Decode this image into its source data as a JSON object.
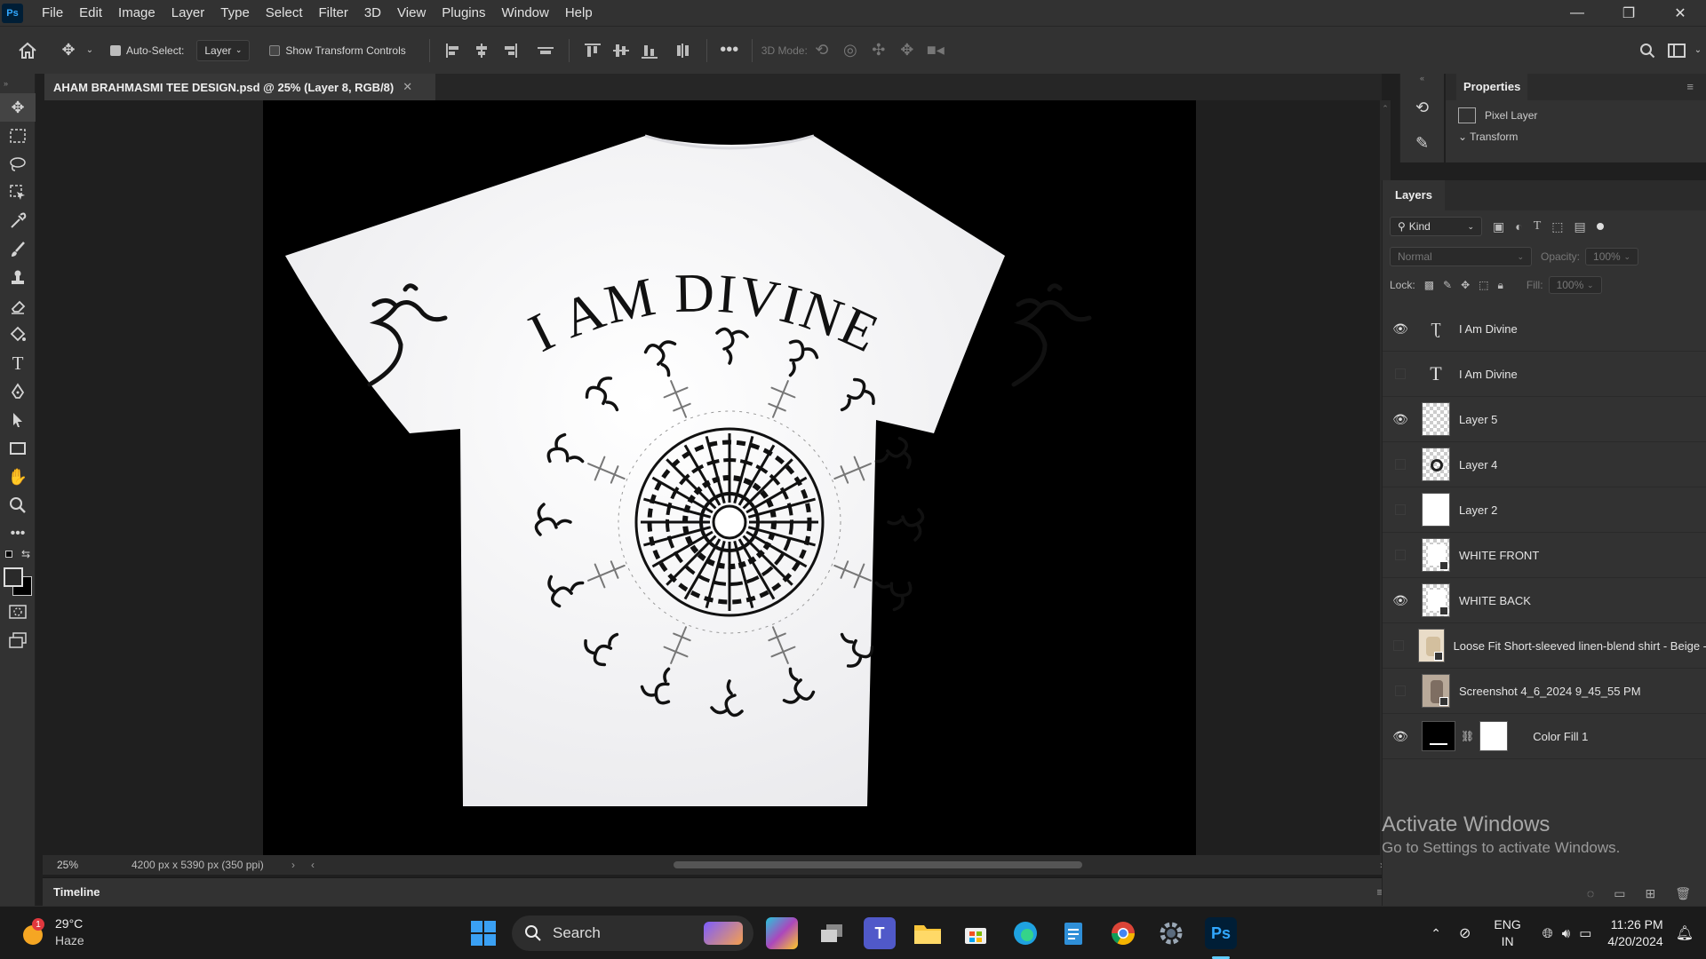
{
  "menubar": {
    "logo": "Ps",
    "items": [
      "File",
      "Edit",
      "Image",
      "Layer",
      "Type",
      "Select",
      "Filter",
      "3D",
      "View",
      "Plugins",
      "Window",
      "Help"
    ]
  },
  "options": {
    "auto_select_label": "Auto-Select:",
    "auto_select_target": "Layer",
    "transform_label": "Show Transform Controls",
    "mode_3d_label": "3D Mode:"
  },
  "document": {
    "tab_title": "AHAM BRAHMASMI TEE DESIGN.psd @ 25% (Layer 8, RGB/8)",
    "zoom": "25%",
    "size": "4200 px x 5390 px (350 ppi)"
  },
  "artwork": {
    "arc_text": "I AM DIVINE"
  },
  "timeline_label": "Timeline",
  "properties": {
    "title": "Properties",
    "pixel_layer": "Pixel Layer",
    "transform": "Transform"
  },
  "layers_panel": {
    "title": "Layers",
    "filter": "Kind",
    "blend_mode": "Normal",
    "opacity_label": "Opacity:",
    "opacity": "100%",
    "lock_label": "Lock:",
    "fill_label": "Fill:",
    "fill": "100%",
    "layers": [
      {
        "name": "I Am Divine",
        "visible": true,
        "kind": "text-warp"
      },
      {
        "name": "I Am Divine",
        "visible": false,
        "kind": "text"
      },
      {
        "name": "Layer 5",
        "visible": true,
        "kind": "pixel"
      },
      {
        "name": "Layer 4",
        "visible": false,
        "kind": "pixel"
      },
      {
        "name": "Layer 2",
        "visible": false,
        "kind": "pixel"
      },
      {
        "name": "WHITE FRONT",
        "visible": false,
        "kind": "smart"
      },
      {
        "name": "WHITE BACK",
        "visible": true,
        "kind": "smart"
      },
      {
        "name": "Loose Fit Short-sleeved linen-blend shirt - Beige -",
        "visible": false,
        "kind": "smart"
      },
      {
        "name": "Screenshot 4_6_2024 9_45_55 PM",
        "visible": false,
        "kind": "smart"
      },
      {
        "name": "Color Fill 1",
        "visible": true,
        "kind": "fill"
      }
    ]
  },
  "watermark": {
    "title": "Activate Windows",
    "subtitle": "Go to Settings to activate Windows."
  },
  "taskbar": {
    "weather_temp": "29°C",
    "weather_desc": "Haze",
    "weather_badge": "1",
    "search": "Search",
    "lang": "ENG",
    "region": "IN",
    "time": "11:26 PM",
    "date": "4/20/2024"
  }
}
